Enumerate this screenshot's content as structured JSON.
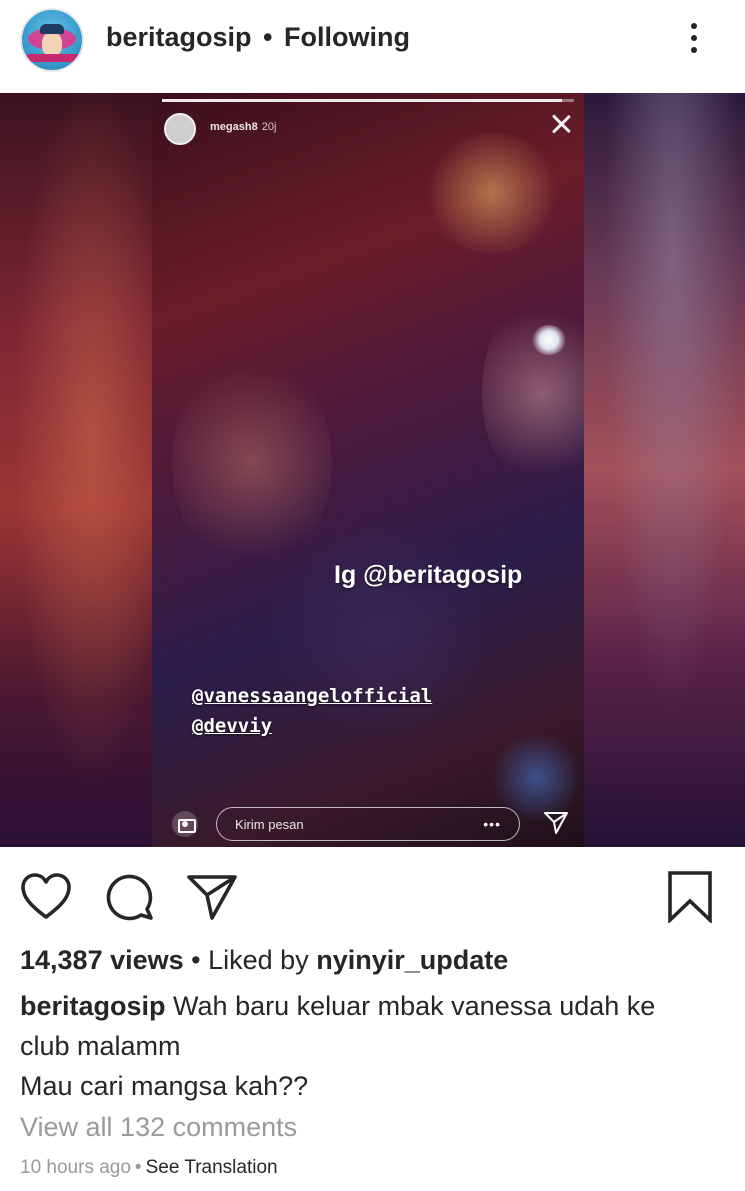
{
  "post": {
    "username": "beritagosip",
    "separator": "•",
    "follow_status": "Following"
  },
  "story": {
    "progress_fraction": 0.97,
    "username": "megash8",
    "time": "20j",
    "watermark": "Ig @beritagosip",
    "mentions": [
      "@vanessaangelofficial",
      "@devviy"
    ],
    "reply_placeholder": "Kirim pesan",
    "reply_more": "•••"
  },
  "icons": {
    "more": "more-vertical-icon",
    "like": "heart-icon",
    "comment": "comment-icon",
    "share": "send-icon",
    "save": "bookmark-icon",
    "close": "close-icon",
    "camera": "camera-icon"
  },
  "stats": {
    "views_count": "14,387 views",
    "separator": "•",
    "liked_by_prefix": "Liked by",
    "liked_by_user": "nyinyir_update"
  },
  "caption": {
    "username": "beritagosip",
    "line1": "Wah baru keluar mbak vanessa udah ke",
    "line2": "club malamm",
    "line3": "Mau cari mangsa kah??"
  },
  "comments": {
    "view_all": "View all 132 comments"
  },
  "meta": {
    "timestamp": "10 hours ago",
    "separator": "•",
    "see_translation": "See Translation"
  }
}
